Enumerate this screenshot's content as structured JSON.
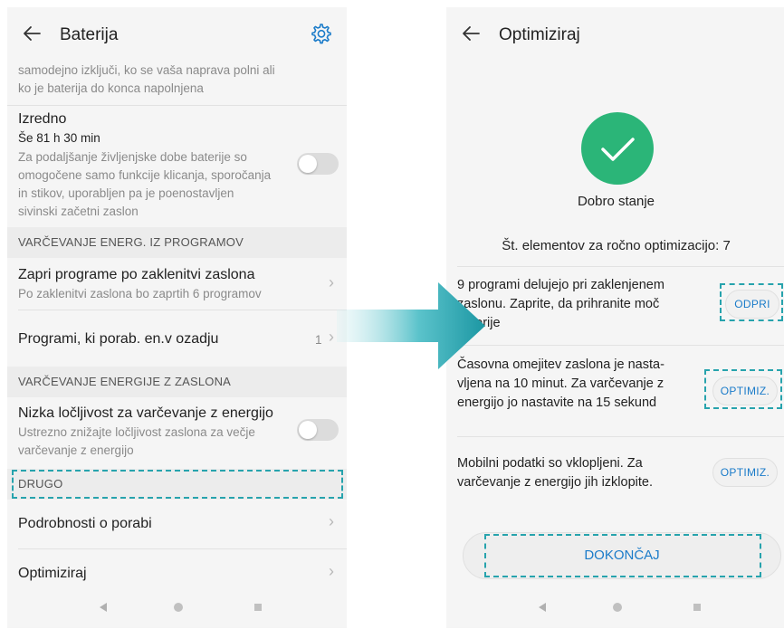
{
  "left": {
    "title": "Baterija",
    "top_desc_line1": "samodejno izključi, ko se vaša naprava polni ali",
    "top_desc_line2": "ko je baterija do konca napolnjena",
    "extreme": {
      "title": "Izredno",
      "time": "Še 81 h 30 min",
      "desc_line1": "Za podaljšanje življenjske dobe baterije so",
      "desc_line2": "omogočene samo funkcije klicanja, sporočanja",
      "desc_line3": "in stikov, uporabljen pa je poenostavljen",
      "desc_line4": "sivinski začetni zaslon",
      "toggle_on": false
    },
    "section1": "VARČEVANJE ENERG. IZ PROGRAMOV",
    "close_apps": {
      "title": "Zapri programe po zaklenitvi zaslona",
      "subtitle": "Po zaklenitvi zaslona bo zaprtih 6 programov"
    },
    "bg_apps": {
      "title": "Programi, ki porab. en.v ozadju",
      "count": "1"
    },
    "section2": "VARČEVANJE ENERGIJE Z ZASLONA",
    "low_res": {
      "title": "Nizka ločljivost za varčevanje z energijo",
      "desc_line1": "Ustrezno znižajte ločljivost zaslona za večje",
      "desc_line2": "varčevanje z energijo",
      "toggle_on": false
    },
    "section3": "DRUGO",
    "usage_details": "Podrobnosti o porabi",
    "optimize": "Optimiziraj"
  },
  "right": {
    "title": "Optimiziraj",
    "status": "Dobro stanje",
    "count_label": "Št. elementov za ročno optimizacijo: 7",
    "items": [
      {
        "line1": "9 programi delujejo pri zaklenjenem",
        "line2": "zaslonu. Zaprite, da prihranite moč",
        "line3": "baterije",
        "button": "ODPRI"
      },
      {
        "line1": "Časovna omejitev zaslona je nasta-",
        "line2": "vljena na 10 minut. Za varčevanje z",
        "line3": "energijo jo nastavite na 15 sekund",
        "button": "OPTIMIZ."
      },
      {
        "line1": "Mobilni podatki so vklopljeni. Za",
        "line2": "varčevanje z energijo jih izklopite.",
        "button": "OPTIMIZ."
      }
    ],
    "done_button": "DOKONČAJ"
  },
  "colors": {
    "accent_blue": "#1a7bc9",
    "success_green": "#2bb578",
    "highlight_teal": "#27a3ad"
  },
  "icons": {
    "back": "arrow-left-icon",
    "settings": "gear-icon",
    "chevron": "chevron-right-icon",
    "check": "check-icon",
    "transition": "arrow-right-icon"
  }
}
